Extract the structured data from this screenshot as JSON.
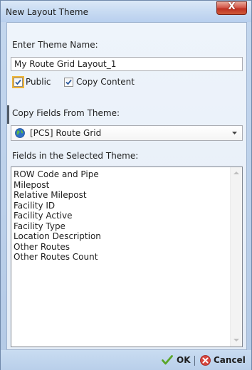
{
  "window": {
    "title": "New Layout Theme",
    "close_label": "X"
  },
  "theme_name": {
    "label": "Enter Theme Name:",
    "value": "My Route Grid Layout_1"
  },
  "options": {
    "public_label": "Public",
    "public_checked": true,
    "copy_content_label": "Copy Content",
    "copy_content_checked": true
  },
  "copy_fields": {
    "label": "Copy Fields From Theme:",
    "selected": "[PCS] Route Grid"
  },
  "fields": {
    "label": "Fields in the Selected Theme:",
    "items": [
      "ROW Code and Pipe",
      "Milepost",
      "Relative Milepost",
      "Facility ID",
      "Facility Active",
      "Facility Type",
      "Location Description",
      "Other Routes",
      "Other Routes Count"
    ]
  },
  "footer": {
    "ok_label": "OK",
    "cancel_label": "Cancel"
  }
}
